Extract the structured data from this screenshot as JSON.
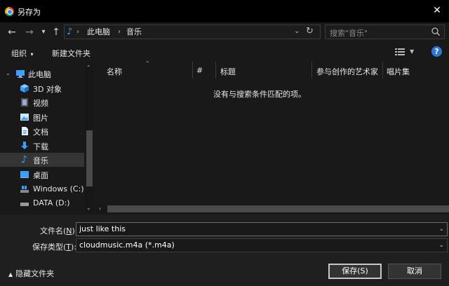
{
  "window": {
    "title": "另存为"
  },
  "nav": {
    "back": "←",
    "forward": "→",
    "history": "⌄",
    "up": "↑",
    "breadcrumb": [
      "此电脑",
      "音乐"
    ],
    "refresh": "↻"
  },
  "search": {
    "placeholder": "搜索\"音乐\""
  },
  "toolbar": {
    "organize": "组织",
    "new_folder": "新建文件夹",
    "help": "?"
  },
  "sidebar": {
    "items": [
      {
        "label": "此电脑",
        "icon": "computer-icon"
      },
      {
        "label": "3D 对象",
        "icon": "cube-icon"
      },
      {
        "label": "视频",
        "icon": "video-icon"
      },
      {
        "label": "图片",
        "icon": "picture-icon"
      },
      {
        "label": "文档",
        "icon": "document-icon"
      },
      {
        "label": "下载",
        "icon": "download-icon"
      },
      {
        "label": "音乐",
        "icon": "music-icon",
        "selected": true
      },
      {
        "label": "桌面",
        "icon": "desktop-icon"
      },
      {
        "label": "Windows (C:)",
        "icon": "windows-drive-icon"
      },
      {
        "label": "DATA (D:)",
        "icon": "drive-icon"
      }
    ]
  },
  "columns": [
    "名称",
    "#",
    "标题",
    "参与创作的艺术家",
    "唱片集"
  ],
  "empty_message": "没有与搜索条件匹配的项。",
  "form": {
    "filename_label": "文件名(N):",
    "filename_mnemonic": "N",
    "filename_value": "just like this",
    "filetype_label": "保存类型(T):",
    "filetype_mnemonic": "T",
    "filetype_value": "cloudmusic.m4a (*.m4a)"
  },
  "footer": {
    "hide_folders": "隐藏文件夹",
    "save": "保存(S)",
    "cancel": "取消"
  },
  "colors": {
    "accent": "#2b78d6",
    "music_icon": "#3aa0ff"
  }
}
